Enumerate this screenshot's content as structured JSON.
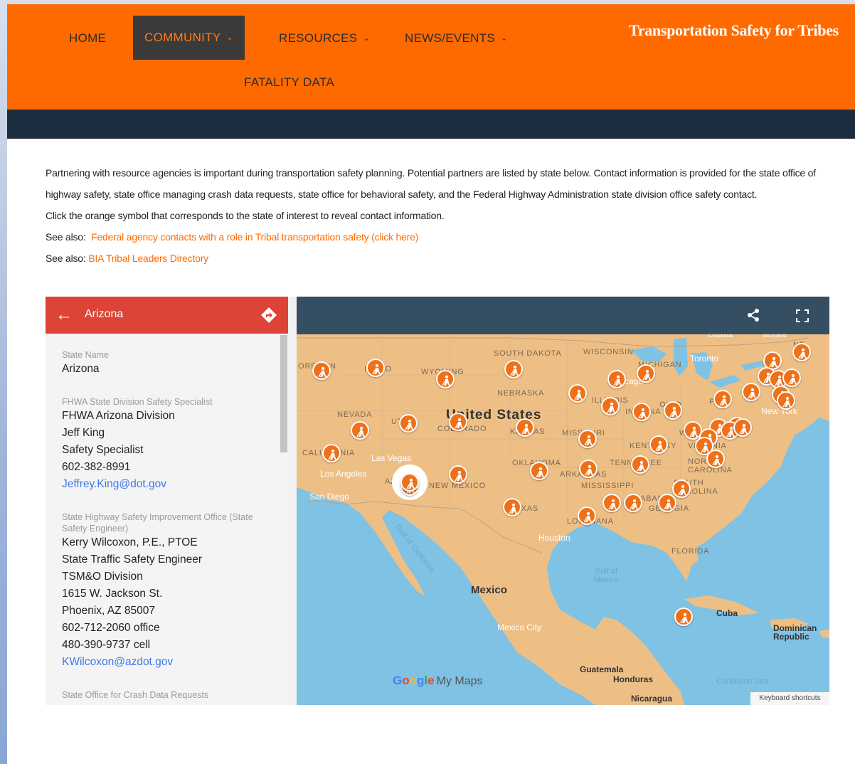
{
  "nav": {
    "items": [
      {
        "label": "HOME"
      },
      {
        "label": "COMMUNITY",
        "chevron": "chevron-down-icon",
        "active": true
      },
      {
        "label": "RESOURCES",
        "chevron": "chevron-down-icon"
      },
      {
        "label": "NEWS/EVENTS",
        "chevron": "chevron-down-icon"
      },
      {
        "label": "FATALITY DATA"
      }
    ],
    "site_title": "Transportation Safety for Tribes"
  },
  "intro": {
    "paragraph": "Partnering with resource agencies is important during transportation safety planning. Potential partners are listed by state below. Contact information is provided for the state office of highway safety, state office managing crash data requests, state office for behavioral safety, and the Federal Highway Administration state division office safety contact.",
    "instruction": "Click the orange symbol that corresponds to the state of interest to reveal contact information.",
    "see_also_prefix": "See also:",
    "link_federal": "Federal agency contacts with a role in Tribal transportation safety (click here)",
    "link_bia": "BIA Tribal Leaders Directory"
  },
  "panel": {
    "title": "Arizona",
    "state_name_label": "State Name",
    "state_name": "Arizona",
    "fhwa_label": "FHWA State Division Safety Specialist",
    "fhwa_lines": [
      "FHWA Arizona Division",
      "Jeff King",
      "Safety Specialist",
      "602-382-8991"
    ],
    "fhwa_email": "Jeffrey.King@dot.gov",
    "hsip_label": "State Highway Safety Improvement Office (State Safety Engineer)",
    "hsip_lines": [
      "Kerry Wilcoxon, P.E., PTOE",
      "State Traffic Safety Engineer",
      "TSM&O Division",
      "1615 W. Jackson St.",
      "Phoenix, AZ 85007",
      "602-712-2060 office",
      "480-390-9737 cell"
    ],
    "hsip_email": "KWilcoxon@azdot.gov",
    "crash_label": "State Office for Crash Data Requests"
  },
  "map": {
    "labels": {
      "united_states": "United States",
      "mexico": "Mexico",
      "cuba": "Cuba",
      "dominican_republic": "Dominican Republic",
      "guatemala": "Guatemala",
      "honduras": "Honduras",
      "nicaragua": "Nicaragua",
      "ottawa": "Ottawa",
      "montreal": "Montre",
      "toronto": "Toronto",
      "chicago": "Chicago",
      "new_york": "New York",
      "las_vegas": "Las Vegas",
      "los_angeles": "Los Angeles",
      "san_diego": "San Diego",
      "houston": "Houston",
      "mexico_city": "Mexico City",
      "gulf_of_california": "Gulf of California",
      "gulf_of_mexico": "Gulf of Mexico",
      "caribbean_sea": "Caribbean Sea",
      "south_dakota": "SOUTH DAKOTA",
      "wisconsin": "WISCONSIN",
      "michigan": "MICHIGAN",
      "nebraska": "NEBRASKA",
      "nevada": "NEVADA",
      "colorado": "COLORADO",
      "kansas": "KANSAS",
      "missouri": "MISSOURI",
      "kentucky": "KENTUCKY",
      "virginia": "VIRGINIA",
      "north_carolina": "NORTH CAROLINA",
      "south_carolina": "SOUTH CAROLINA",
      "tennessee": "TENNESSEE",
      "oklahoma": "OKLAHOMA",
      "arkansas": "ARKANSAS",
      "mississippi": "MISSISSIPPI",
      "alabama": "ALABAMA",
      "georgia": "GEORGIA",
      "louisiana": "LOUISIANA",
      "texas": "TEXAS",
      "florida": "FLORIDA",
      "new_mexico": "NEW MEXICO",
      "california": "CALIFORNIA",
      "oregon": "OREGON",
      "idaho": "IDAHO",
      "wyoming": "WYOMING",
      "utah": "UTAH",
      "arizona": "AZ",
      "illinois": "ILLINOIS",
      "indiana": "INDIANA",
      "ohio": "OHIO",
      "pennsylvania": "PA",
      "new_hampshire": "NE",
      "wv": "WV"
    },
    "google_brand": "Google",
    "my_maps": "My Maps",
    "keyboard_shortcuts": "Keyboard shortcuts",
    "marker_icon": "worker-icon",
    "share_icon": "share-icon",
    "fullscreen_icon": "fullscreen-icon"
  },
  "colors": {
    "header_orange": "#ff6a00",
    "dark_band": "#1c2d3f",
    "panel_red": "#db4437",
    "marker_orange": "#f07018",
    "link_blue": "#3b78e7"
  }
}
